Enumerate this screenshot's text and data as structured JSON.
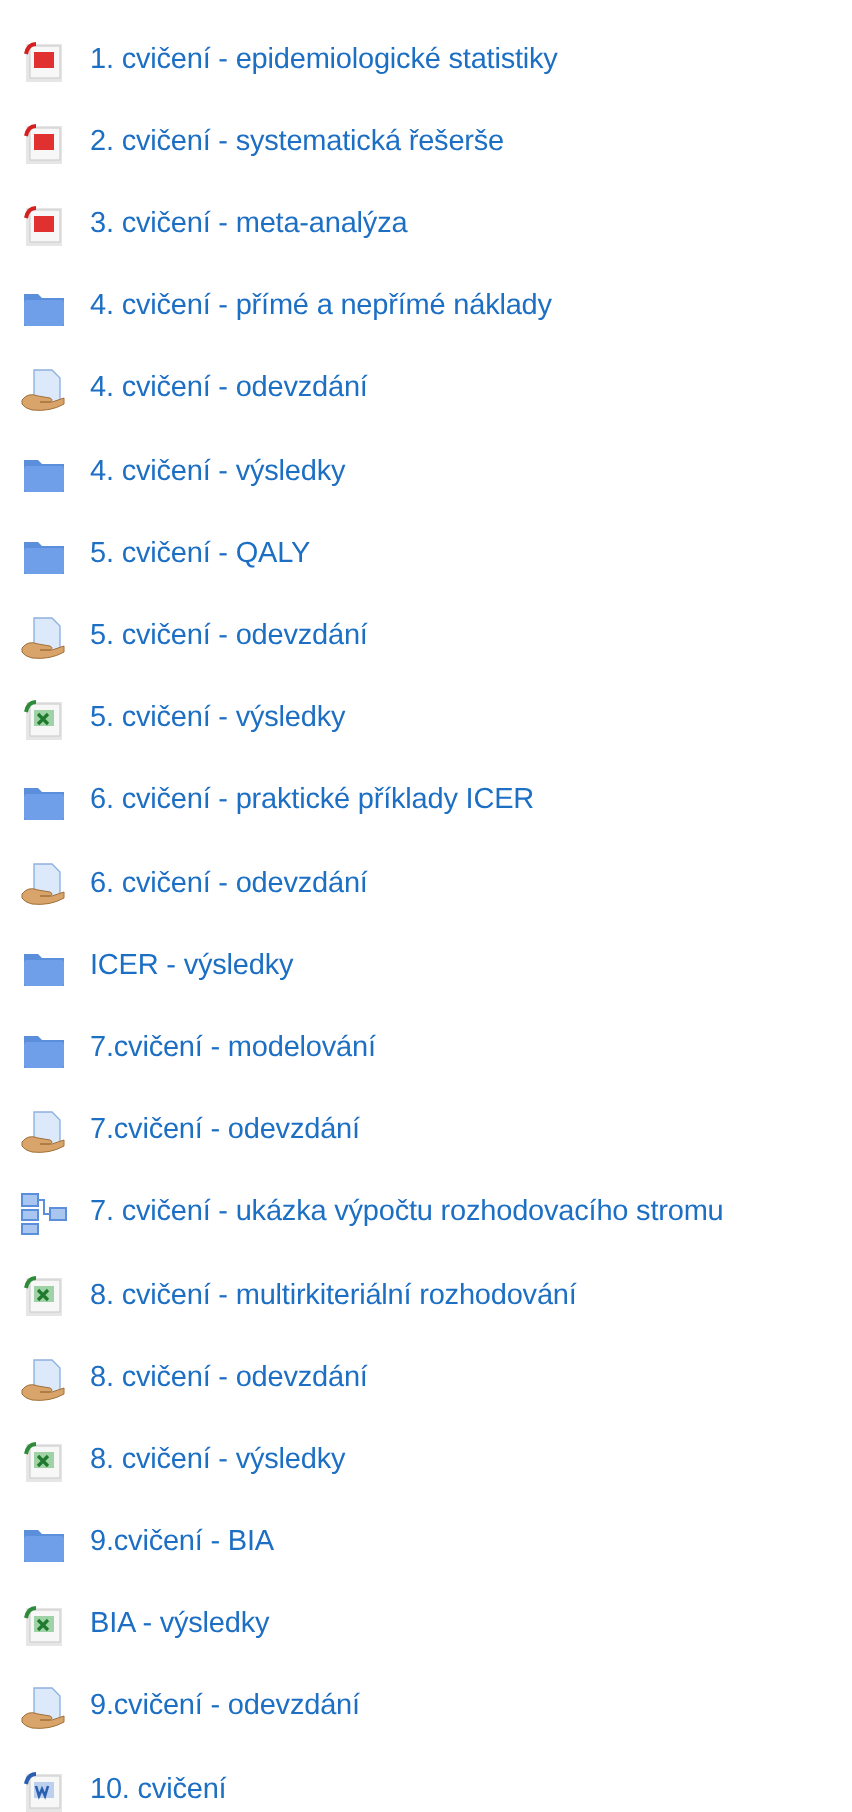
{
  "activities": [
    {
      "kind": "pdf",
      "title": "1. cvičení - epidemiologické statistiky"
    },
    {
      "kind": "pdf",
      "title": "2. cvičení - systematická řešerše"
    },
    {
      "kind": "pdf",
      "title": "3. cvičení - meta-analýza"
    },
    {
      "kind": "folder",
      "title": "4. cvičení - přímé a nepřímé náklady"
    },
    {
      "kind": "assignment",
      "title": "4. cvičení - odevzdání"
    },
    {
      "kind": "folder",
      "title": "4. cvičení - výsledky"
    },
    {
      "kind": "folder",
      "title": "5. cvičení - QALY"
    },
    {
      "kind": "assignment",
      "title": "5. cvičení - odevzdání"
    },
    {
      "kind": "spreadsheet",
      "title": "5. cvičení - výsledky"
    },
    {
      "kind": "folder",
      "title": "6. cvičení - praktické příklady ICER"
    },
    {
      "kind": "assignment",
      "title": "6. cvičení - odevzdání"
    },
    {
      "kind": "folder",
      "title": "ICER - výsledky"
    },
    {
      "kind": "folder",
      "title": "7.cvičení - modelování"
    },
    {
      "kind": "assignment",
      "title": "7.cvičení - odevzdání"
    },
    {
      "kind": "diagram",
      "title": "7. cvičení - ukázka výpočtu rozhodovacího stromu"
    },
    {
      "kind": "spreadsheet",
      "title": "8. cvičení - multirkiteriální rozhodování"
    },
    {
      "kind": "assignment",
      "title": "8. cvičení - odevzdání"
    },
    {
      "kind": "spreadsheet",
      "title": "8. cvičení - výsledky"
    },
    {
      "kind": "folder",
      "title": "9.cvičení - BIA"
    },
    {
      "kind": "spreadsheet",
      "title": "BIA - výsledky"
    },
    {
      "kind": "assignment",
      "title": "9.cvičení - odevzdání"
    },
    {
      "kind": "document",
      "title": "10. cvičení"
    }
  ]
}
